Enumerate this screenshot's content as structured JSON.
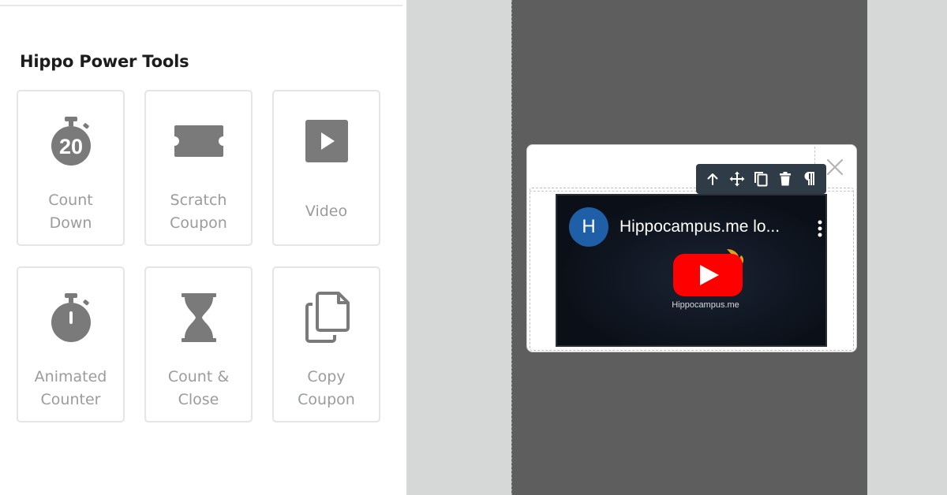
{
  "panel": {
    "title": "Hippo Power Tools",
    "tools": [
      {
        "line1": "Count",
        "line2": "Down",
        "icon": "stopwatch-20-icon",
        "badge": "20"
      },
      {
        "line1": "Scratch",
        "line2": "Coupon",
        "icon": "ticket-icon"
      },
      {
        "line1": "Video",
        "line2": "",
        "icon": "play-square-icon"
      },
      {
        "line1": "Animated",
        "line2": "Counter",
        "icon": "stopwatch-icon"
      },
      {
        "line1": "Count &",
        "line2": "Close",
        "icon": "hourglass-icon"
      },
      {
        "line1": "Copy",
        "line2": "Coupon",
        "icon": "copy-icon"
      }
    ]
  },
  "toolbar": {
    "items": [
      "arrow-up-icon",
      "move-icon",
      "duplicate-icon",
      "trash-icon",
      "pilcrow-icon"
    ]
  },
  "video": {
    "channel_initial": "H",
    "title": "Hippocampus.me lo...",
    "caption": "Hippocampus.me"
  },
  "colors": {
    "icon_gray": "#7a7a7a",
    "label_gray": "#999c9d",
    "canvas": "#5e5e5e",
    "toolbar": "#2f3b46",
    "youtube_red": "#ff0000",
    "avatar_blue": "#1f5fa8"
  }
}
